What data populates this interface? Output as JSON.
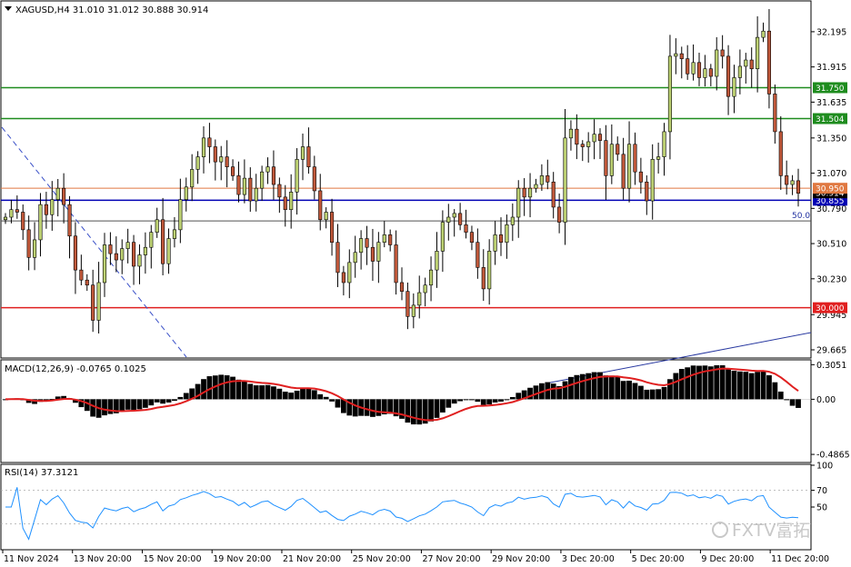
{
  "window": {
    "symbol_header": "XAGUSD,H4  31.010 31.012 30.888 30.914",
    "macd_header": "MACD(12,26,9) -0.0765 0.1025",
    "rsi_header": "RSI(14) 37.3121",
    "watermark": "FXTV富拓"
  },
  "chart_data": [
    {
      "type": "candlestick",
      "title": "XAGUSD,H4  31.010 31.012 30.888 30.914",
      "ohlc_current": {
        "open": 31.01,
        "high": 31.012,
        "low": 30.888,
        "close": 30.914
      },
      "y_ticks": [
        "32.195",
        "31.915",
        "31.635",
        "31.350",
        "31.070",
        "30.790",
        "30.510",
        "30.230",
        "29.945",
        "29.665"
      ],
      "x_ticks": [
        "11 Nov 2024",
        "13 Nov 20:00",
        "15 Nov 20:00",
        "19 Nov 20:00",
        "21 Nov 20:00",
        "25 Nov 20:00",
        "27 Nov 20:00",
        "29 Nov 20:00",
        "3 Dec 20:00",
        "5 Dec 20:00",
        "9 Dec 20:00",
        "11 Dec 20:00"
      ],
      "ylim": [
        29.6,
        32.44
      ],
      "horizontal_levels": [
        {
          "value": 31.75,
          "label": "31.750",
          "color": "#1e8c1e"
        },
        {
          "value": 31.504,
          "label": "31.504",
          "color": "#1e8c1e"
        },
        {
          "value": 30.855,
          "label": "30.855",
          "color": "#0000b4"
        },
        {
          "value": 30.0,
          "label": "30.000",
          "color": "#e02020"
        },
        {
          "value": 30.914,
          "label": "30.914",
          "color": "#000000"
        },
        {
          "value": 30.95,
          "label": "30.950",
          "color": "#e07840"
        }
      ],
      "fib_level": {
        "value": 30.69,
        "label": "50.0"
      },
      "candle_colors": {
        "up": "#bcd072",
        "down": "#c0583a",
        "wick": "#000000"
      },
      "closes": [
        30.72,
        30.78,
        30.76,
        30.62,
        30.4,
        30.54,
        30.82,
        30.74,
        30.86,
        30.95,
        30.82,
        30.57,
        30.3,
        30.22,
        30.18,
        29.9,
        30.2,
        30.5,
        30.43,
        30.38,
        30.47,
        30.52,
        30.33,
        30.42,
        30.48,
        30.6,
        30.7,
        30.35,
        30.55,
        30.62,
        30.86,
        30.96,
        31.1,
        31.2,
        31.35,
        31.28,
        31.16,
        31.2,
        31.12,
        31.05,
        30.9,
        31.03,
        30.85,
        30.95,
        31.08,
        31.12,
        30.98,
        30.88,
        30.78,
        30.92,
        31.18,
        31.28,
        31.12,
        30.93,
        30.7,
        30.76,
        30.52,
        30.28,
        30.2,
        30.36,
        30.44,
        30.55,
        30.48,
        30.37,
        30.52,
        30.58,
        30.5,
        30.2,
        30.13,
        29.93,
        30.02,
        30.12,
        30.18,
        30.3,
        30.45,
        30.68,
        30.72,
        30.75,
        30.66,
        30.6,
        30.52,
        30.32,
        30.15,
        30.45,
        30.58,
        30.52,
        30.66,
        30.72,
        30.95,
        30.88,
        30.95,
        30.98,
        31.05,
        31.0,
        30.8,
        30.68,
        31.35,
        31.42,
        31.3,
        31.28,
        31.32,
        31.38,
        31.33,
        31.05,
        31.3,
        31.22,
        30.95,
        31.3,
        31.08,
        31.0,
        30.85,
        31.18,
        31.2,
        31.4,
        32.0,
        32.02,
        31.98,
        31.86,
        31.95,
        31.83,
        31.9,
        31.84,
        32.05,
        32.0,
        31.68,
        31.83,
        31.92,
        31.97,
        31.9,
        32.15,
        32.2,
        31.7,
        31.4,
        31.05,
        30.98,
        31.01,
        30.91
      ],
      "macd": {
        "name": "MACD(12,26,9)",
        "value": -0.0765,
        "signal_value": 0.1025,
        "y_ticks": [
          "0.3051",
          "0.00",
          "-0.4865"
        ],
        "ylim": [
          -0.55,
          0.34
        ]
      },
      "rsi": {
        "name": "RSI(14)",
        "value": 37.3121,
        "y_ticks": [
          "100",
          "70",
          "50"
        ],
        "levels": [
          70,
          30
        ],
        "ylim": [
          0,
          100
        ]
      }
    }
  ]
}
